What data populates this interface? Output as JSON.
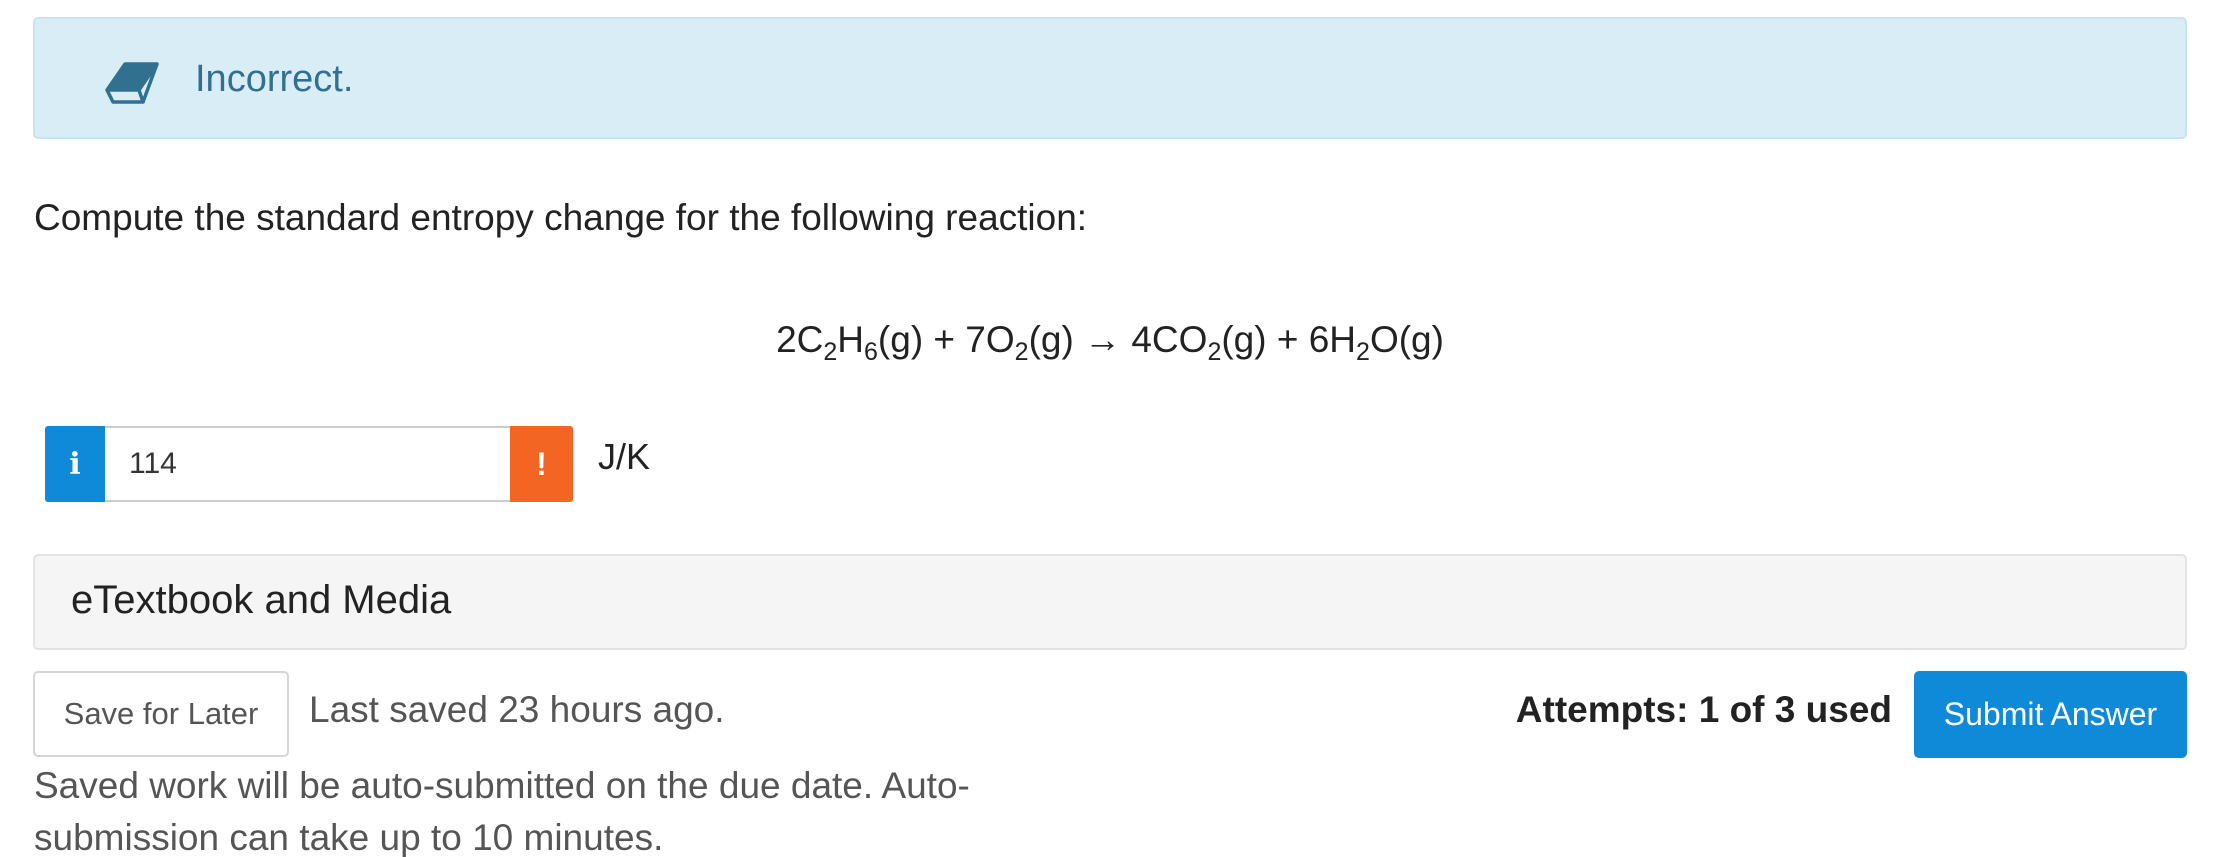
{
  "alert": {
    "icon": "eraser-icon",
    "text": "Incorrect.",
    "color": "#31708f",
    "background": "#d9edf7"
  },
  "question": {
    "prompt": "Compute the standard entropy change for the following reaction:",
    "equation": {
      "t1_coef": "2C",
      "t1_sub1": "2",
      "t1_mid": "H",
      "t1_sub2": "6",
      "t1_end": "(g) + 7O",
      "t2_sub": "2",
      "t2_end": "(g) → 4CO",
      "t3_sub": "2",
      "t3_end": "(g) + 6H",
      "t4_sub": "2",
      "t4_end": "O(g)"
    }
  },
  "answer": {
    "info_icon": "info-icon",
    "value": "114",
    "warning_icon": "exclamation-icon",
    "warning_symbol": "!",
    "info_symbol": "i",
    "unit": "J/K",
    "info_color": "#0f8ad8",
    "warning_color": "#f26522"
  },
  "etextbook": {
    "label": "eTextbook and Media"
  },
  "footer": {
    "save_label": "Save for Later",
    "last_saved": "Last saved 23 hours ago.",
    "auto_note": "Saved work will be auto-submitted on the due date. Auto-submission can take up to 10 minutes.",
    "attempts": "Attempts: 1 of 3 used",
    "submit_label": "Submit Answer",
    "submit_color": "#0f8ad8"
  }
}
